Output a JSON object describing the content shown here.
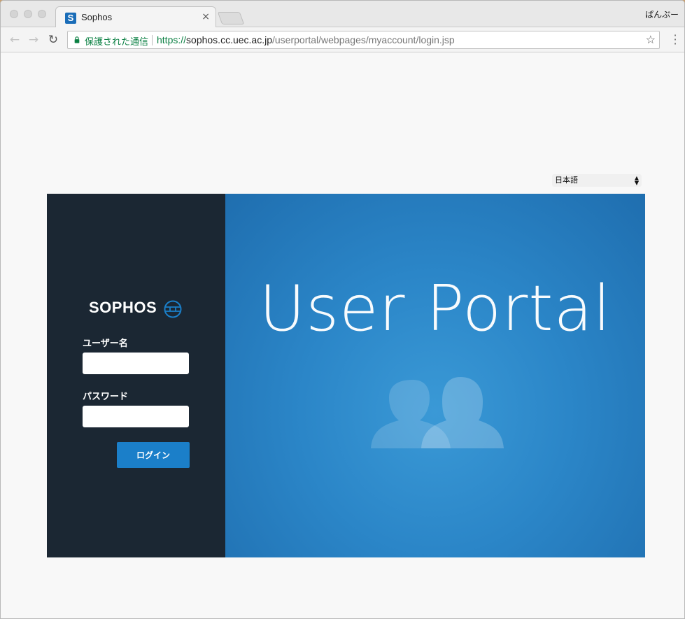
{
  "browser": {
    "tab": {
      "favicon_letter": "S",
      "title": "Sophos",
      "close_glyph": "×"
    },
    "profile_name": "ぱんぷー",
    "toolbar": {
      "back_glyph": "←",
      "forward_glyph": "→",
      "reload_glyph": "↻",
      "secure_label": "保護された通信",
      "url_scheme": "https://",
      "url_host": "sophos.cc.uec.ac.jp",
      "url_path": "/userportal/webpages/myaccount/login.jsp",
      "bookmark_glyph": "☆"
    },
    "colors": {
      "secure_green": "#0b8043",
      "favicon_blue": "#1a6db8"
    }
  },
  "page": {
    "language_select": {
      "selected": "日本語"
    },
    "logo": {
      "text": "SOPHOS",
      "icon": "globe-icon"
    },
    "form": {
      "username_label": "ユーザー名",
      "username_value": "",
      "password_label": "パスワード",
      "password_value": "",
      "login_label": "ログイン"
    },
    "hero": {
      "title": "User Portal",
      "icon": "users-icon"
    },
    "colors": {
      "left_panel": "#1b2733",
      "hero_blue": "#2b86c8",
      "button_blue": "#1b7fc9"
    }
  }
}
